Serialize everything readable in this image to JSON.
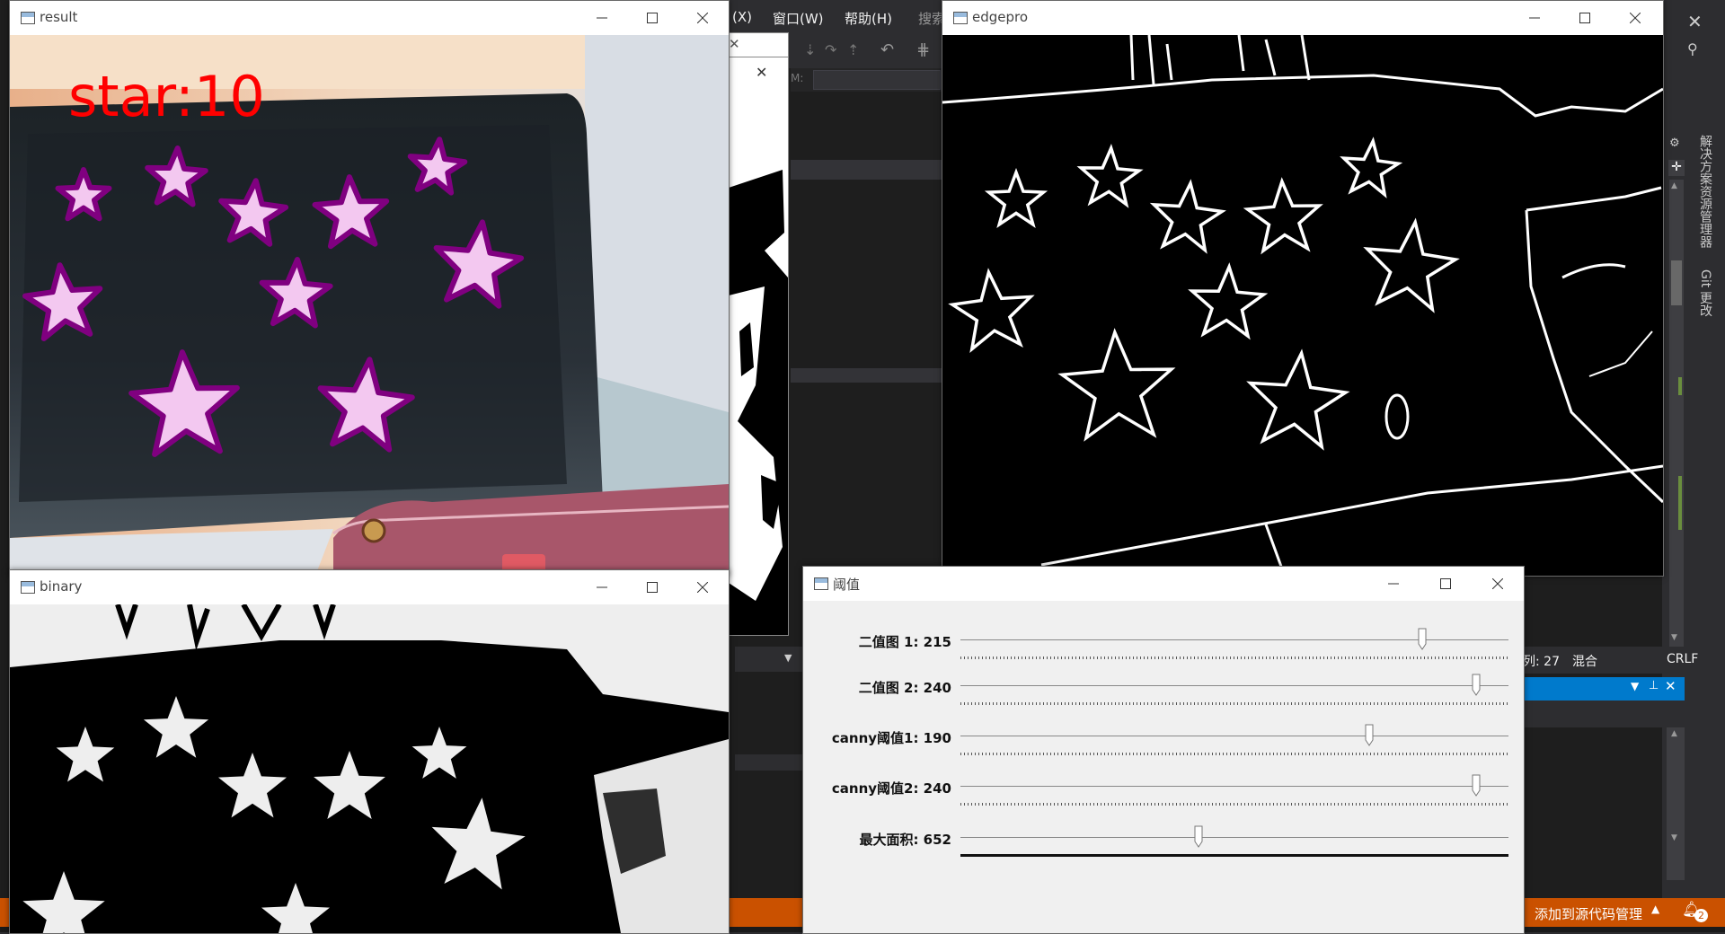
{
  "vs": {
    "menu": [
      "(X)",
      "窗口(W)",
      "帮助(H)",
      "搜索"
    ],
    "status": {
      "col": "列: 27",
      "mode": "混合",
      "eol": "CRLF"
    },
    "source_control": "添加到源代码管理",
    "notifications": "2",
    "side_tabs": [
      "解决方案资源管理器",
      "Git 更改"
    ],
    "mini_label": "M:"
  },
  "windows": {
    "result": {
      "title": "result",
      "overlay_text": "star:10",
      "star_count": 10
    },
    "binary": {
      "title": "binary"
    },
    "edgepro": {
      "title": "edgepro"
    },
    "threshold": {
      "title": "阈值",
      "trackbars": [
        {
          "label": "二值图 1: 215",
          "value": 215,
          "max": 255
        },
        {
          "label": "二值图 2: 240",
          "value": 240,
          "max": 255
        },
        {
          "label": "canny阈值1: 190",
          "value": 190,
          "max": 255
        },
        {
          "label": "canny阈值2: 240",
          "value": 240,
          "max": 255
        },
        {
          "label": "最大面积: 652",
          "value": 652,
          "max": 1500
        }
      ]
    }
  },
  "colors": {
    "vs_bg": "#1e1e1e",
    "vs_panel": "#2d2d30",
    "vs_blue": "#007acc",
    "vs_orange": "#ca5100",
    "star_fill": "#f3c8f0",
    "star_outline": "#800080",
    "overlay_red": "#ff0000"
  }
}
